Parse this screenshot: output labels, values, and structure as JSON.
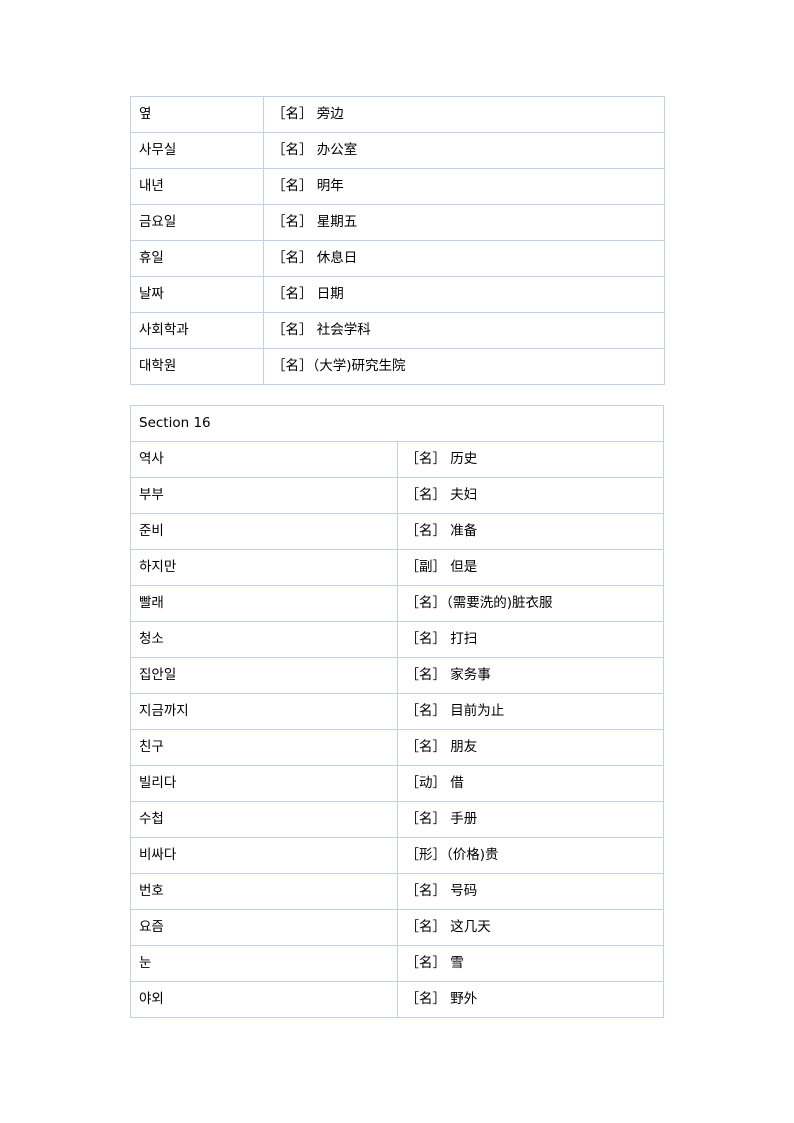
{
  "document": {
    "type": "vocabulary-list",
    "colors": {
      "page_background": "#ffffff",
      "table_border": "#c4d0e3",
      "body_text": "#000000",
      "section_heading": "#2b2bd4"
    }
  },
  "tables": [
    {
      "id": "table-1",
      "heading": null,
      "rows": [
        {
          "word": "옆",
          "definition": "［名］ 旁边"
        },
        {
          "word": "사무실",
          "definition": "［名］ 办公室"
        },
        {
          "word": "내년",
          "definition": "［名］ 明年"
        },
        {
          "word": "금요일",
          "definition": "［名］ 星期五"
        },
        {
          "word": "휴일",
          "definition": "［名］ 休息日"
        },
        {
          "word": "날짜",
          "definition": "［名］ 日期"
        },
        {
          "word": "사회학과",
          "definition": "［名］ 社会学科"
        },
        {
          "word": "대학원",
          "definition": "［名］（大学)研究生院"
        }
      ]
    },
    {
      "id": "table-2",
      "heading": "Section 16",
      "rows": [
        {
          "word": "역사",
          "definition": "［名］ 历史"
        },
        {
          "word": "부부",
          "definition": "［名］ 夫妇"
        },
        {
          "word": "준비",
          "definition": "［名］ 准备"
        },
        {
          "word": "하지만",
          "definition": "［副］ 但是"
        },
        {
          "word": "빨래",
          "definition": "［名］（需要洗的)脏衣服"
        },
        {
          "word": "청소",
          "definition": "［名］ 打扫"
        },
        {
          "word": "집안일",
          "definition": "［名］ 家务事"
        },
        {
          "word": "지금까지",
          "definition": "［名］ 目前为止"
        },
        {
          "word": "친구",
          "definition": "［名］ 朋友"
        },
        {
          "word": "빌리다",
          "definition": "［动］ 借"
        },
        {
          "word": "수첩",
          "definition": "［名］ 手册"
        },
        {
          "word": "비싸다",
          "definition": "［形］（价格)贵"
        },
        {
          "word": "번호",
          "definition": "［名］ 号码"
        },
        {
          "word": "요즘",
          "definition": "［名］ 这几天"
        },
        {
          "word": "눈",
          "definition": "［名］ 雪"
        },
        {
          "word": "야외",
          "definition": "［名］ 野外"
        }
      ]
    }
  ]
}
